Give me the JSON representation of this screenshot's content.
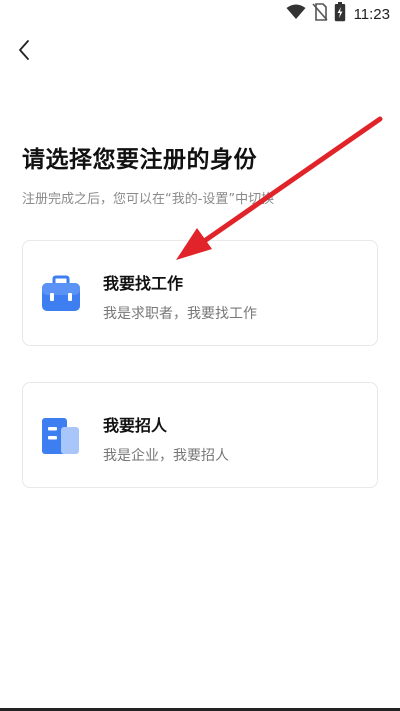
{
  "status_bar": {
    "time": "11:23",
    "icons": [
      "wifi-icon",
      "no-sim-icon",
      "battery-charging-icon"
    ]
  },
  "nav": {
    "back_icon": "chevron-left-icon"
  },
  "header": {
    "title": "请选择您要注册的身份",
    "subtitle": "注册完成之后，您可以在“我的-设置”中切换"
  },
  "options": [
    {
      "title": "我要找工作",
      "description": "我是求职者，我要找工作",
      "icon": "briefcase-icon"
    },
    {
      "title": "我要招人",
      "description": "我是企业，我要招人",
      "icon": "building-icon"
    }
  ],
  "colors": {
    "accent_blue": "#3d7ef0",
    "annotation_red": "#e0242a"
  }
}
